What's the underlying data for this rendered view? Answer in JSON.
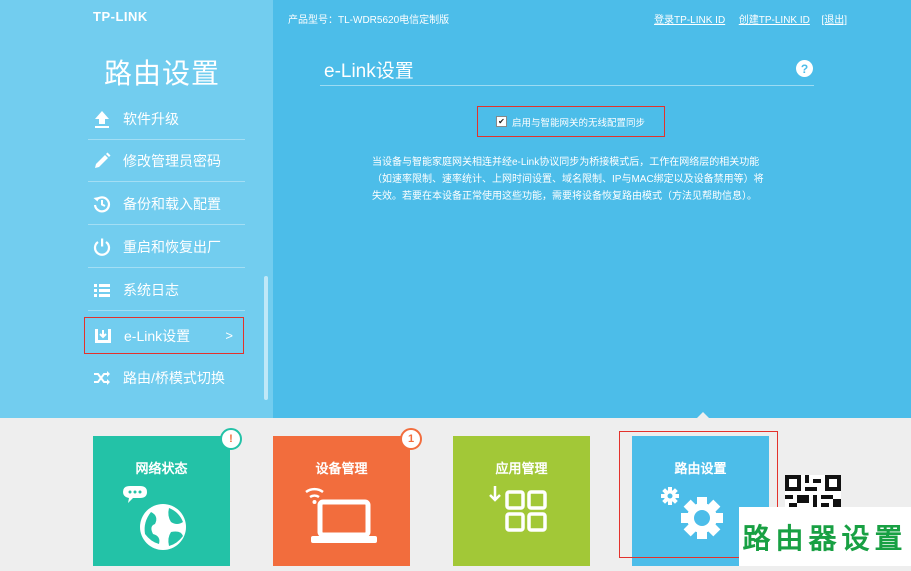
{
  "header": {
    "logo": "TP-LINK",
    "model": "产品型号：TL-WDR5620电信定制版",
    "link_login": "登录TP-LINK ID",
    "link_create": "创建TP-LINK ID",
    "link_exit": "[退出]"
  },
  "sidebar": {
    "title": "路由设置",
    "items": [
      {
        "label": "软件升级",
        "icon": "upload-icon"
      },
      {
        "label": "修改管理员密码",
        "icon": "pencil-icon"
      },
      {
        "label": "备份和载入配置",
        "icon": "history-icon"
      },
      {
        "label": "重启和恢复出厂",
        "icon": "power-icon"
      },
      {
        "label": "系统日志",
        "icon": "list-icon"
      },
      {
        "label": "e-Link设置",
        "icon": "download-tray-icon",
        "active": true,
        "chevron": ">"
      },
      {
        "label": "路由/桥模式切换",
        "icon": "shuffle-icon"
      }
    ]
  },
  "main": {
    "title": "e-Link设置",
    "help": "?",
    "checkbox_label": "启用与智能网关的无线配置同步",
    "checkbox_checked": true,
    "description": "当设备与智能家庭网关相连并经e-Link协议同步为桥接模式后，工作在网络层的相关功能（如速率限制、速率统计、上网时间设置、域名限制、IP与MAC绑定以及设备禁用等）将失效。若要在本设备正常使用这些功能，需要将设备恢复路由模式（方法见帮助信息）。"
  },
  "tiles": [
    {
      "label": "网络状态",
      "color": "#23c2a7",
      "badge": "!"
    },
    {
      "label": "设备管理",
      "color": "#f26d3d",
      "badge": "1"
    },
    {
      "label": "应用管理",
      "color": "#a2c837"
    },
    {
      "label": "路由设置",
      "color": "#4cbde9",
      "active": true
    }
  ],
  "watermark": "路由器设置"
}
